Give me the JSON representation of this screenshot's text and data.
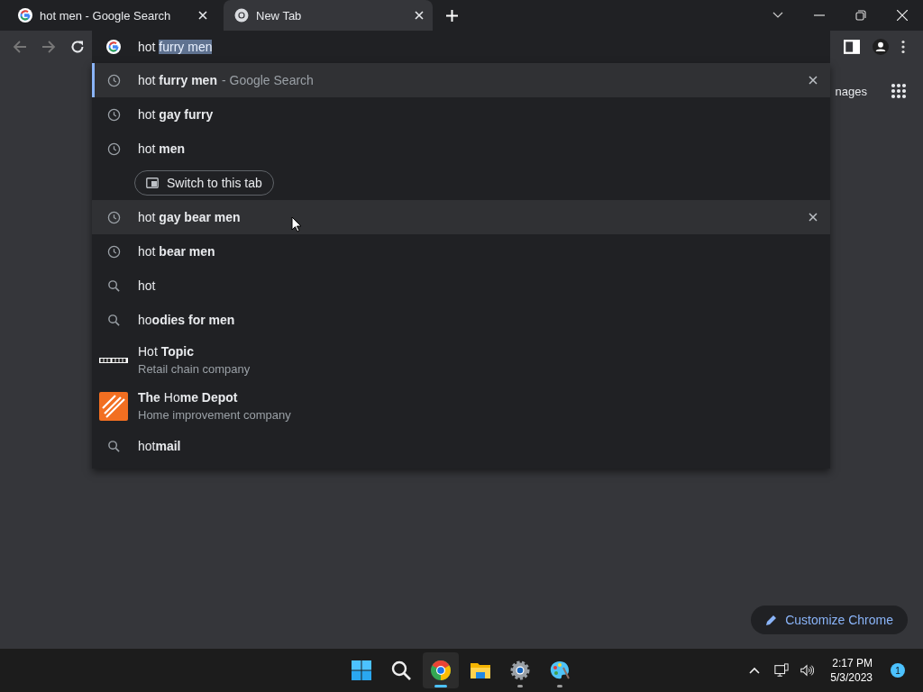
{
  "tabs": [
    {
      "title": "hot men - Google Search",
      "kind": "search-page",
      "selected": false
    },
    {
      "title": "New Tab",
      "kind": "new-tab",
      "selected": true
    }
  ],
  "omnibox": {
    "typed": "hot ",
    "completion": "furry men"
  },
  "suggestions": [
    {
      "kind": "history",
      "text": "hot **furry men**",
      "suffix": "- Google Search",
      "selected": true,
      "hovered": false
    },
    {
      "kind": "history",
      "text": "hot **gay furry**",
      "selected": false,
      "hovered": false
    },
    {
      "kind": "history",
      "text": "hot **men**",
      "action": "Switch to this tab",
      "selected": false,
      "hovered": false
    },
    {
      "kind": "history",
      "text": "hot **gay bear men**",
      "selected": false,
      "hovered": true
    },
    {
      "kind": "history",
      "text": "hot **bear men**",
      "selected": false,
      "hovered": false
    },
    {
      "kind": "search",
      "text": "hot",
      "selected": false,
      "hovered": false
    },
    {
      "kind": "search",
      "text": "ho**odies for men**",
      "selected": false,
      "hovered": false
    },
    {
      "kind": "brand-wordmark",
      "text": "Hot **Topic**",
      "subtitle": "Retail chain company",
      "selected": false,
      "hovered": false
    },
    {
      "kind": "brand-tile",
      "text": "**The** Ho**me Depot**",
      "subtitle": "Home improvement company",
      "selected": false,
      "hovered": false
    },
    {
      "kind": "search",
      "text": "hot**mail**",
      "selected": false,
      "hovered": false
    }
  ],
  "page": {
    "partial_link": "nages",
    "customize_button": "Customize Chrome"
  },
  "taskbar": {
    "apps": [
      {
        "kind": "start",
        "running": false,
        "active": false
      },
      {
        "kind": "search",
        "running": false,
        "active": false
      },
      {
        "kind": "chrome",
        "running": true,
        "active": true
      },
      {
        "kind": "files",
        "running": false,
        "active": false
      },
      {
        "kind": "settings",
        "running": true,
        "active": false
      },
      {
        "kind": "paint",
        "running": true,
        "active": false
      }
    ],
    "time": "2:17 PM",
    "date": "5/3/2023",
    "notifications": "1"
  }
}
